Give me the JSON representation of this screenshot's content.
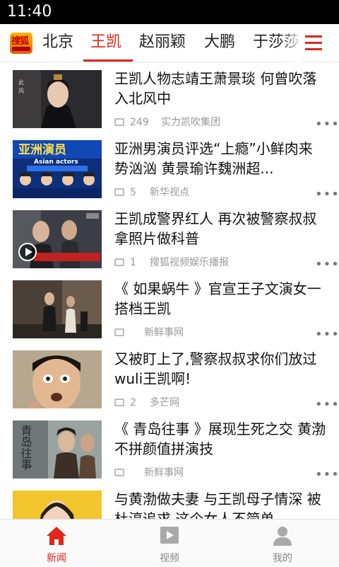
{
  "status_bar": {
    "time": "11:40"
  },
  "tabs": {
    "items": [
      {
        "label": "北京",
        "active": false
      },
      {
        "label": "王凯",
        "active": true
      },
      {
        "label": "赵丽颖",
        "active": false
      },
      {
        "label": "大鹏",
        "active": false
      },
      {
        "label": "于莎莎",
        "active": false
      }
    ],
    "logo_text": "搜狐",
    "accent_color": "#e0261b"
  },
  "feed": [
    {
      "title": "王凯人物志靖王萧景琰 何曾吹落入北风中",
      "comments": "249",
      "source": "实力凯吹集团",
      "has_video": false,
      "thumb_theme": "costume"
    },
    {
      "title": "亚洲男演员评选“上瘾”小鲜肉来势汹汹 黄景瑜许魏洲超...",
      "comments": "5",
      "source": "新华视点",
      "has_video": false,
      "thumb_theme": "poster",
      "thumb_text": "亚洲演员",
      "thumb_subtext": "Asian actors"
    },
    {
      "title": "王凯成警界红人 再次被警察叔叔拿照片做科普",
      "comments": "1",
      "source": "搜狐视频娱乐播报",
      "has_video": true,
      "thumb_theme": "video"
    },
    {
      "title": "《 如果蜗牛 》官宣王子文演女一搭档王凯",
      "comments": "",
      "source": "新鲜事网",
      "has_video": false,
      "thumb_theme": "studio"
    },
    {
      "title": "又被盯上了,警察叔叔求你们放过wuli王凯啊!",
      "comments": "2",
      "source": "多芒网",
      "has_video": false,
      "thumb_theme": "face"
    },
    {
      "title": "《 青岛往事 》展现生死之交 黄渤不拼颜值拼演技",
      "comments": "",
      "source": "新鲜事网",
      "has_video": false,
      "thumb_theme": "drama",
      "thumb_text": "青岛往事"
    },
    {
      "title": "与黄渤做夫妻 与王凯母子情深 被杜淳追求 这个女人不简单",
      "comments": "",
      "source": "",
      "has_video": false,
      "thumb_theme": "actress"
    }
  ],
  "bottom_nav": [
    {
      "label": "新闻",
      "icon": "home-icon",
      "active": true
    },
    {
      "label": "视频",
      "icon": "video-icon",
      "active": false
    },
    {
      "label": "我的",
      "icon": "profile-icon",
      "active": false
    }
  ]
}
